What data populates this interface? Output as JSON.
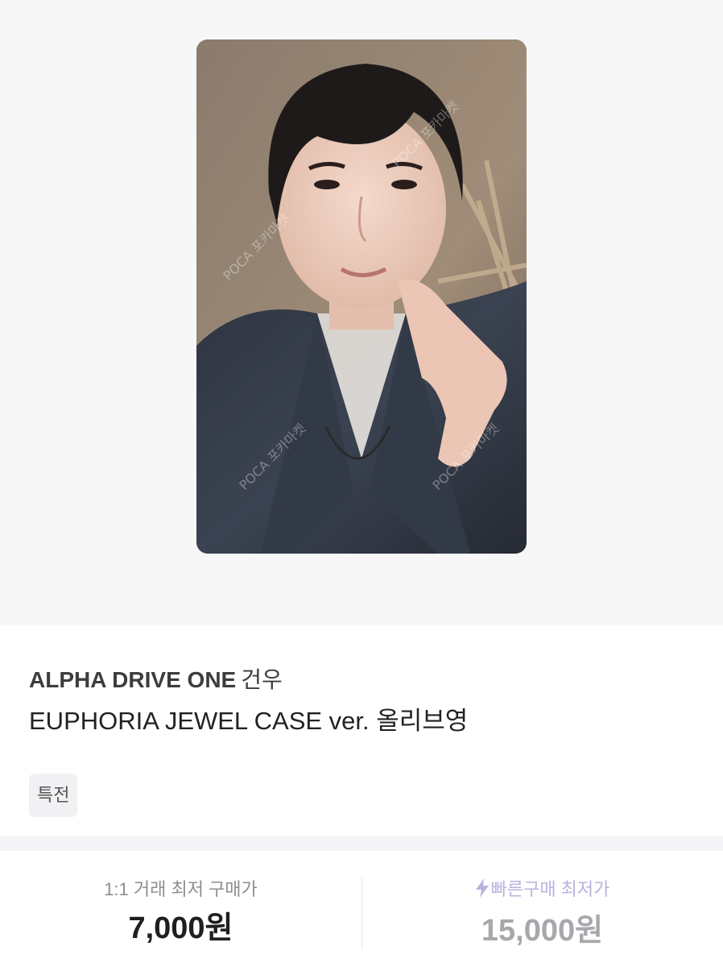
{
  "product": {
    "group": "ALPHA DRIVE ONE",
    "member": "건우",
    "title": "EUPHORIA JEWEL CASE ver. 올리브영",
    "tag": "특전",
    "image_alt": "photocard of a person in a denim jacket making a finger pose",
    "watermark": "POCA 포카마켓"
  },
  "prices": {
    "one_to_one": {
      "label": "1:1 거래 최저 구매가",
      "value": "7,000원"
    },
    "fast_buy": {
      "label": "빠른구매 최저가",
      "value": "15,000원",
      "icon": "lightning-bolt-icon"
    }
  },
  "colors": {
    "hero_bg": "#f7f7f8",
    "fast_accent": "#b8b2de",
    "tag_bg": "#f1f1f3"
  }
}
